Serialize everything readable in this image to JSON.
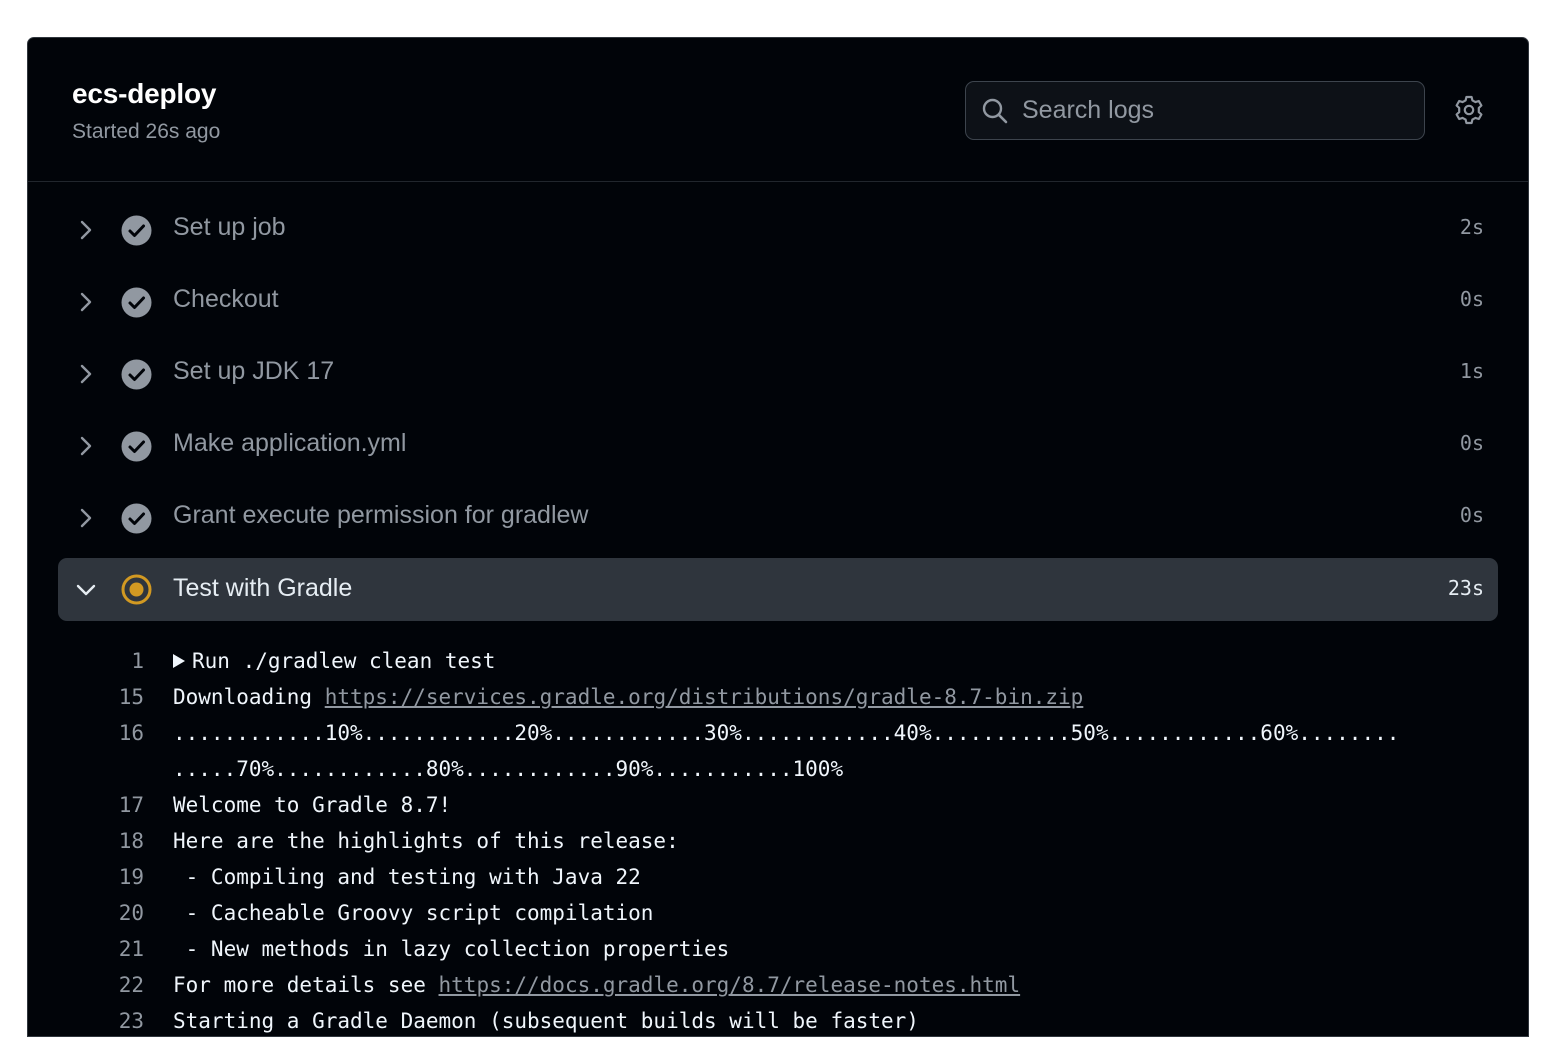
{
  "job": {
    "title": "ecs-deploy",
    "subtitle": "Started 26s ago"
  },
  "search": {
    "placeholder": "Search logs",
    "value": ""
  },
  "icons": {
    "search": "search-icon",
    "settings": "gear-icon",
    "expand": "chevron-right-icon",
    "collapse": "chevron-down-icon",
    "success": "check-circle-icon",
    "running": "in-progress-icon"
  },
  "colors": {
    "background": "#010409",
    "success_icon": "#9198a1",
    "running_icon": "#d29922",
    "active_row": "#2f353d"
  },
  "steps": [
    {
      "name": "Set up job",
      "duration": "2s",
      "status": "success",
      "expanded": false
    },
    {
      "name": "Checkout",
      "duration": "0s",
      "status": "success",
      "expanded": false
    },
    {
      "name": "Set up JDK 17",
      "duration": "1s",
      "status": "success",
      "expanded": false
    },
    {
      "name": "Make application.yml",
      "duration": "0s",
      "status": "success",
      "expanded": false
    },
    {
      "name": "Grant execute permission for gradlew",
      "duration": "0s",
      "status": "success",
      "expanded": false
    },
    {
      "name": "Test with Gradle",
      "duration": "23s",
      "status": "in_progress",
      "expanded": true
    }
  ],
  "log": [
    {
      "num": "1",
      "text": "Run ./gradlew clean test",
      "collapsed_group": true
    },
    {
      "num": "15",
      "prefix": "Downloading ",
      "link": "https://services.gradle.org/distributions/gradle-8.7-bin.zip"
    },
    {
      "num": "16",
      "text": "............10%............20%............30%............40%...........50%............60%........"
    },
    {
      "num": "",
      "text": ".....70%............80%............90%...........100%"
    },
    {
      "num": "17",
      "text": "Welcome to Gradle 8.7!"
    },
    {
      "num": "18",
      "text": "Here are the highlights of this release:"
    },
    {
      "num": "19",
      "text": " - Compiling and testing with Java 22"
    },
    {
      "num": "20",
      "text": " - Cacheable Groovy script compilation"
    },
    {
      "num": "21",
      "text": " - New methods in lazy collection properties"
    },
    {
      "num": "22",
      "prefix": "For more details see ",
      "link": "https://docs.gradle.org/8.7/release-notes.html"
    },
    {
      "num": "23",
      "text": "Starting a Gradle Daemon (subsequent builds will be faster)"
    }
  ]
}
